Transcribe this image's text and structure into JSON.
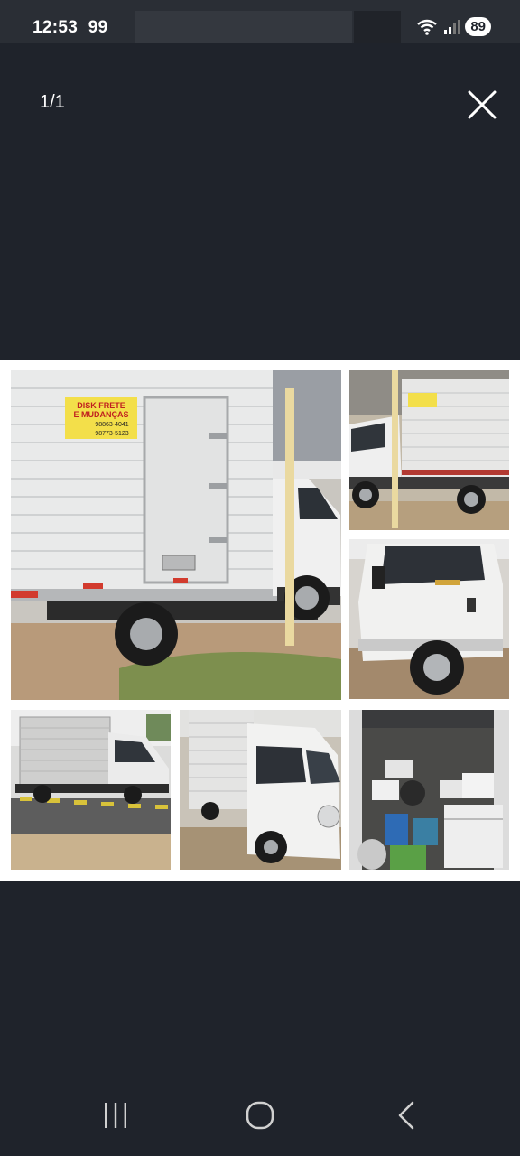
{
  "status_bar": {
    "time": "12:53",
    "notification": "99",
    "battery": "89",
    "wifi_icon": "wifi-icon",
    "signal_icon": "signal-icon"
  },
  "viewer": {
    "counter": "1/1",
    "close_icon": "close-icon"
  },
  "collage": {
    "photos": [
      {
        "name": "truck-rear-photo",
        "sign_line1": "DISK FRETE",
        "sign_line2": "E MUDANÇAS",
        "phone1": "98863-4041",
        "phone2": "98773-5123"
      },
      {
        "name": "truck-side-photo",
        "sign_line1": "DISK FRETE"
      },
      {
        "name": "truck-cab-photo"
      },
      {
        "name": "truck-street-photo"
      },
      {
        "name": "truck-front-photo"
      },
      {
        "name": "cargo-interior-photo"
      }
    ]
  },
  "nav_bar": {
    "recents_icon": "recents-icon",
    "home_icon": "home-icon",
    "back_icon": "back-icon"
  }
}
